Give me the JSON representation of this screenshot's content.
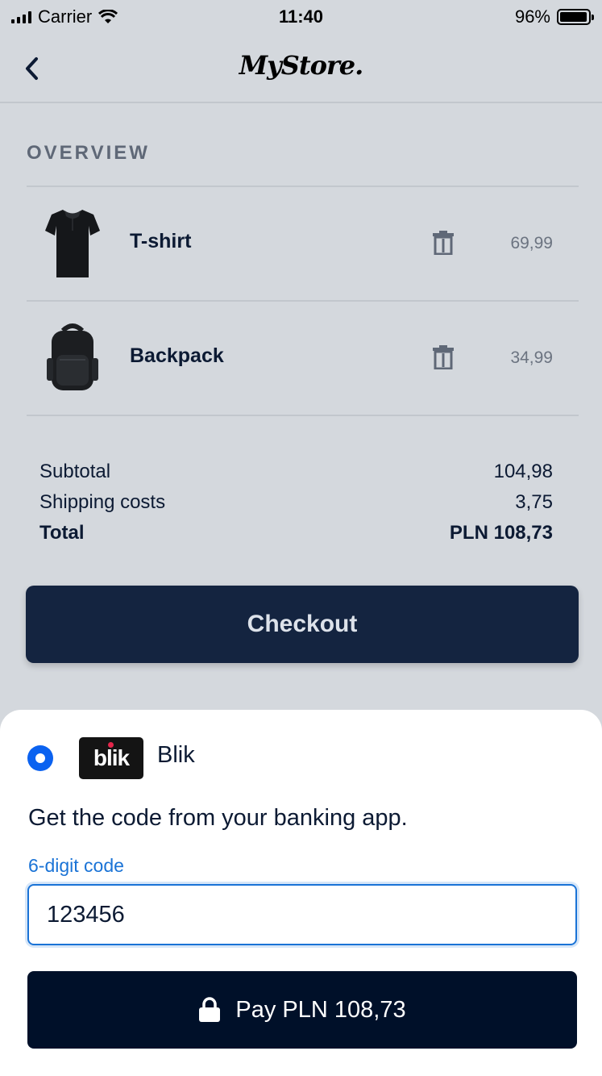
{
  "status_bar": {
    "carrier": "Carrier",
    "time": "11:40",
    "battery": "96%",
    "battery_level": 0.96
  },
  "nav": {
    "back_icon": "chevron-left-icon",
    "logo": "MyStore."
  },
  "overview": {
    "title": "OVERVIEW",
    "items": [
      {
        "name": "T-shirt",
        "price": "69,99",
        "image": "tshirt-image",
        "action_icon": "trash-icon"
      },
      {
        "name": "Backpack",
        "price": "34,99",
        "image": "backpack-image",
        "action_icon": "trash-icon"
      }
    ]
  },
  "summary": {
    "subtotal_label": "Subtotal",
    "subtotal_value": "104,98",
    "shipping_label": "Shipping costs",
    "shipping_value": "3,75",
    "total_label": "Total",
    "total_value": "PLN 108,73"
  },
  "checkout": {
    "label": "Checkout"
  },
  "payment": {
    "method_logo": "blik",
    "method_label": "Blik",
    "instruction": "Get the code from your banking app.",
    "code_label": "6-digit code",
    "code_value": "123456",
    "pay_label": "Pay PLN 108,73",
    "pay_icon": "lock-icon"
  },
  "colors": {
    "background": "#d4d8dd",
    "primary_dark": "#142440",
    "pay_button": "#001029",
    "accent_blue": "#1a73d6",
    "radio_blue": "#0b62f0"
  }
}
